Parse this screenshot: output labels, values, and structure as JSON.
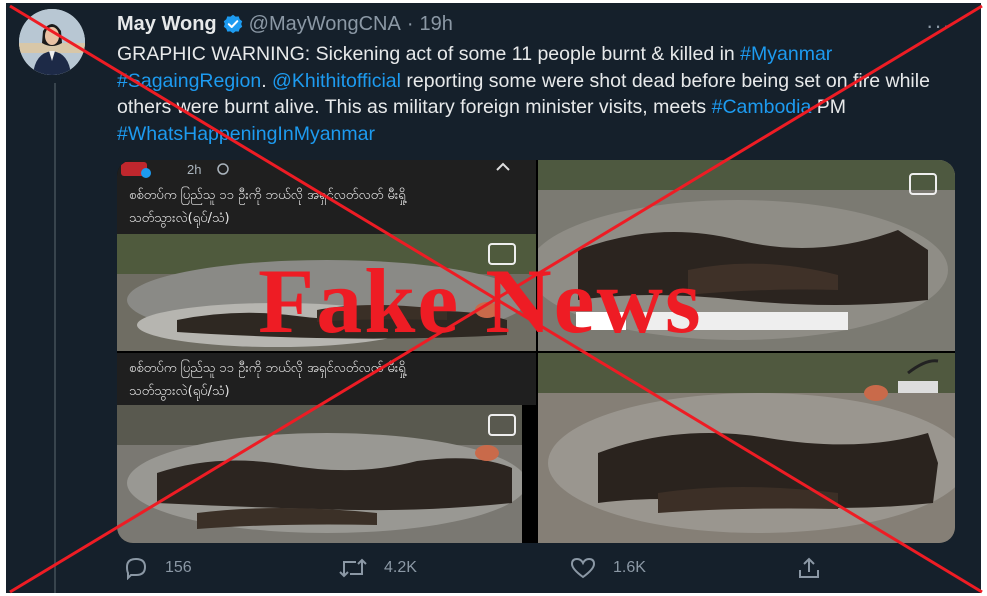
{
  "tweet": {
    "display_name": "May Wong",
    "handle": "@MayWongCNA",
    "separator": "·",
    "time": "19h",
    "text_parts": [
      {
        "text": "GRAPHIC WARNING: Sickening act of some 11 people burnt & killed in ",
        "link": false
      },
      {
        "text": "#Myanmar",
        "link": true
      },
      {
        "text": " ",
        "link": false
      },
      {
        "text": "#SagaingRegion",
        "link": true
      },
      {
        "text": ". ",
        "link": false
      },
      {
        "text": "@Khithitofficial",
        "link": true
      },
      {
        "text": " reporting some were shot dead before being set on fire while others were burnt alive. This as military foreign minister visits, meets ",
        "link": false
      },
      {
        "text": "#Cambodia",
        "link": true
      },
      {
        "text": " PM ",
        "link": false
      },
      {
        "text": "#WhatsHappeningInMyanmar",
        "link": true
      }
    ]
  },
  "media": {
    "post_time": "2h",
    "caption_line1": "စစ်တပ်က ပြည်သူ ၁၁ ဦးကို ဘယ်လို အရှင်လတ်လတ် မီးရှို့",
    "caption_line2": "သတ်သွားလဲ(ရုပ်/သံ)",
    "caption2_line1": "စစ်တပ်က ပြည်သူ ၁၁ ဦးကို ဘယ်လို အရှင်လတ်လတ် မီးရှို့",
    "caption2_line2": "သတ်သွားလဲ(ရုပ်/သံ)"
  },
  "actions": {
    "replies": "156",
    "retweets": "4.2K",
    "likes": "1.6K"
  },
  "overlay": {
    "stamp_text": "Fake News",
    "stamp_color": "#ee1c24"
  },
  "colors": {
    "background": "#15202b",
    "text": "#e7e9ea",
    "muted": "#8b98a5",
    "link": "#1d9bf0",
    "verified": "#1d9bf0"
  },
  "icons": [
    "verified-badge-icon",
    "more-options-icon",
    "reply-icon",
    "retweet-icon",
    "like-icon",
    "share-icon",
    "cast-icon",
    "globe-icon"
  ]
}
